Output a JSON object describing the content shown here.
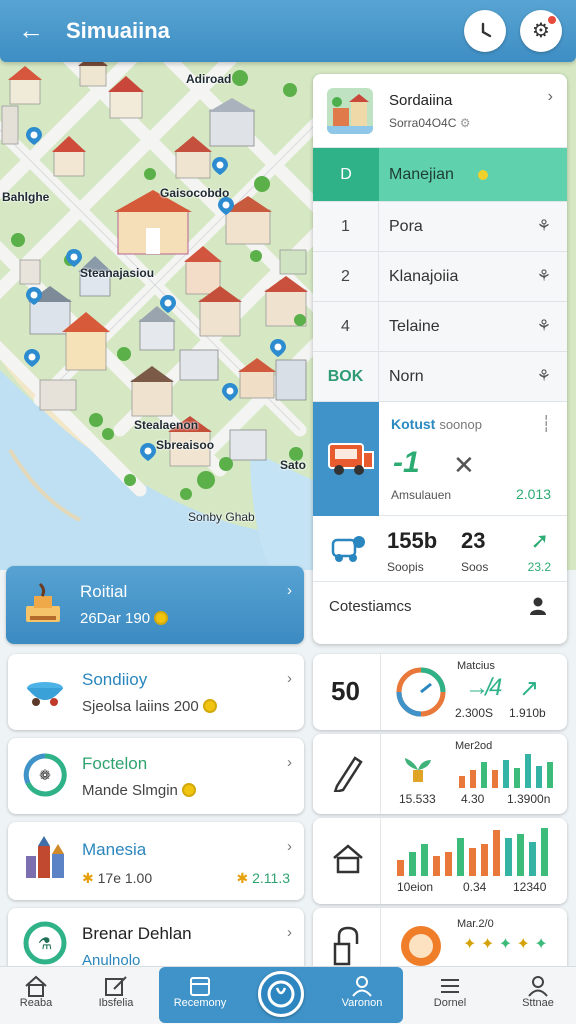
{
  "header": {
    "title": "Simuaiina",
    "back_icon": "arrow-left-icon",
    "clock_icon": "clock-icon",
    "settings_icon": "gear-icon"
  },
  "map": {
    "labels": [
      "Adiroad",
      "Bahlghe",
      "Gaisocobdo",
      "Steanajasiou",
      "Stealaenon",
      "Sbreaisoo",
      "Sato",
      "Sonby Ghab"
    ]
  },
  "side_panel": {
    "title": "Sordaiina",
    "subtitle": "Sorra04O4C",
    "rows": [
      {
        "key": "D",
        "value": "Manejian"
      },
      {
        "key": "1",
        "value": "Pora"
      },
      {
        "key": "2",
        "value": "Klanajoiia"
      },
      {
        "key": "4",
        "value": "Telaine"
      },
      {
        "key": "BOK",
        "value": "Norn"
      }
    ],
    "vehicle_card": {
      "title": "Kotust",
      "title_suffix": "soonop",
      "value": "-1",
      "label": "Amsulauen",
      "number": "2.013"
    },
    "stats": {
      "value1": "155b",
      "caption1": "Soopis",
      "value2": "23",
      "caption2": "Soos",
      "caption3": "23.2"
    },
    "footer_label": "Cotestiamcs"
  },
  "left_cards": [
    {
      "title": "Roitial",
      "subtitle": "26Dar 190"
    },
    {
      "title": "Sondiioy",
      "subtitle": "Sjeolsa laiins 200"
    },
    {
      "title": "Foctelon",
      "subtitle": "Mande Slmgin"
    },
    {
      "title": "Manesia",
      "subtitle": "17e 1.00",
      "extra": "2.11.3"
    },
    {
      "title": "Brenar Dehlan",
      "subtitle": "Anulnolo"
    }
  ],
  "stat_cards": {
    "card1": {
      "big": "50",
      "label": "Matcius",
      "v1": "2.300S",
      "v2": "1.910b"
    },
    "card2": {
      "label": "Mer2od",
      "c1": "15.533",
      "c2": "4.30",
      "c3": "1.3900n"
    },
    "card3": {
      "c1": "10eion",
      "c2": "0.34",
      "c3": "12340"
    },
    "card4": {
      "label": "Mar.2/0"
    }
  },
  "bottom_nav": [
    {
      "label": "Reaba",
      "icon": "home-icon"
    },
    {
      "label": "Ibsfelia",
      "icon": "edit-icon"
    },
    {
      "label": "Recemony",
      "icon": "calendar-icon"
    },
    {
      "label": "Varonon",
      "icon": "person-icon"
    },
    {
      "label": "Dornel",
      "icon": "menu-icon"
    },
    {
      "label": "Sttnae",
      "icon": "profile-icon"
    }
  ],
  "colors": {
    "primary": "#3f93c9",
    "accent_green": "#2fb288",
    "highlight": "#5fd1ad",
    "chart_orange": "#e8793a",
    "chart_green": "#3dbb7a",
    "chart_teal": "#35b3a4"
  }
}
